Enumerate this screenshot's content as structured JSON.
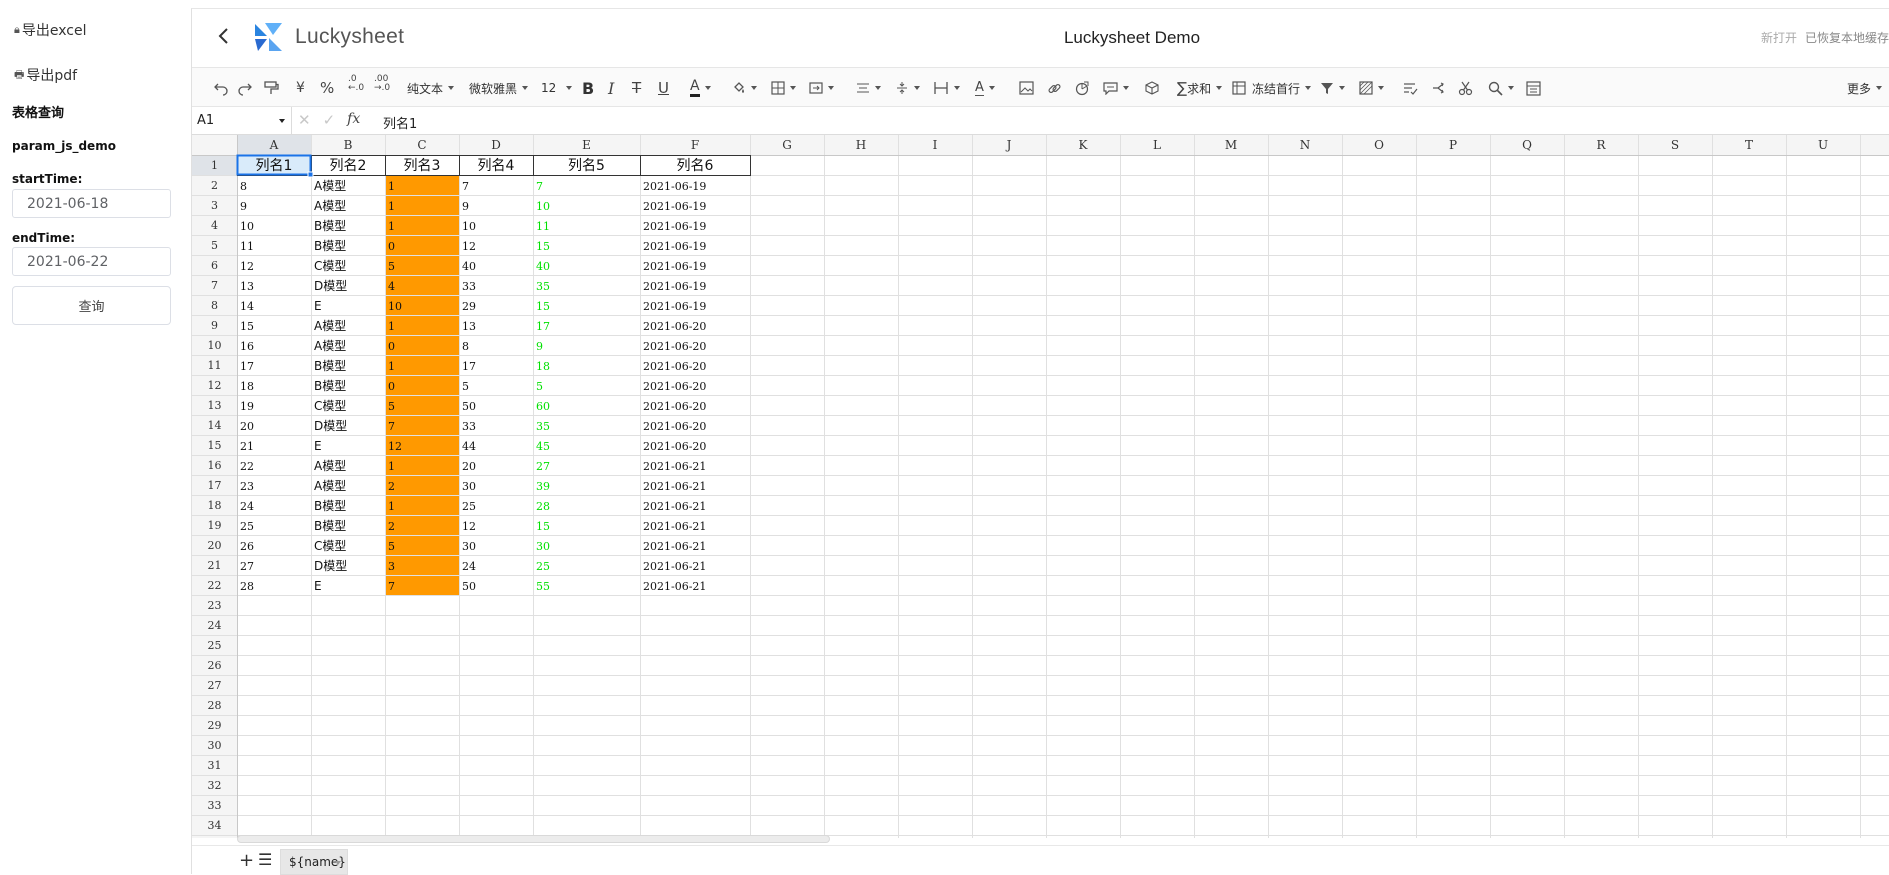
{
  "left_panel": {
    "export_excel": "导出excel",
    "export_pdf": "导出pdf",
    "section_title": "表格查询",
    "report_name": "param_js_demo",
    "start_label": "startTime:",
    "start_value": "2021-06-18",
    "end_label": "endTime:",
    "end_value": "2021-06-22",
    "query_button": "查询"
  },
  "header": {
    "brand": "Luckysheet",
    "title": "Luckysheet Demo",
    "status_new": "新打开",
    "status_cache": "已恢复本地缓存"
  },
  "toolbar": {
    "format_label": "纯文本",
    "font_label": "微软雅黑",
    "size_label": "12",
    "sum_label": "求和",
    "freeze_label": "冻结首行",
    "more_label": "更多",
    "icons": [
      "undo-icon",
      "redo-icon",
      "paint-format-icon",
      "currency-icon",
      "percent-icon",
      "decrease-decimal-icon",
      "increase-decimal-icon",
      "bold-icon",
      "italic-icon",
      "strikethrough-icon",
      "underline-icon",
      "text-color-icon",
      "fill-color-icon",
      "border-icon",
      "merge-icon",
      "align-icon",
      "valign-icon",
      "text-wrap-icon",
      "text-rotate-icon",
      "image-icon",
      "link-icon",
      "chart-icon",
      "comment-icon",
      "pivot-icon",
      "sum-icon",
      "freeze-icon",
      "filter-icon",
      "conditional-format-icon",
      "data-validation-icon",
      "split-icon",
      "screenshot-icon",
      "search-icon",
      "print-icon"
    ]
  },
  "formula_bar": {
    "cell_ref": "A1",
    "fx": "fx",
    "value": "列名1"
  },
  "grid": {
    "columns": [
      "A",
      "B",
      "C",
      "D",
      "E",
      "F",
      "G",
      "H",
      "I",
      "J",
      "K",
      "L",
      "M",
      "N",
      "O",
      "P",
      "Q",
      "R",
      "S",
      "T",
      "U"
    ],
    "row_numbers": [
      "1",
      "2",
      "3",
      "4",
      "5",
      "6",
      "7",
      "8",
      "9",
      "10",
      "11",
      "12",
      "13",
      "14",
      "15",
      "16",
      "17",
      "18",
      "19",
      "20",
      "21",
      "22",
      "23",
      "24",
      "25",
      "26",
      "27",
      "28",
      "29",
      "30",
      "31",
      "32",
      "33",
      "34"
    ],
    "header_row": [
      "列名1",
      "列名2",
      "列名3",
      "列名4",
      "列名5",
      "列名6"
    ],
    "rows": [
      [
        "8",
        "A模型",
        "1",
        "7",
        "7",
        "2021-06-19"
      ],
      [
        "9",
        "A模型",
        "1",
        "9",
        "10",
        "2021-06-19"
      ],
      [
        "10",
        "B模型",
        "1",
        "10",
        "11",
        "2021-06-19"
      ],
      [
        "11",
        "B模型",
        "0",
        "12",
        "15",
        "2021-06-19"
      ],
      [
        "12",
        "C模型",
        "5",
        "40",
        "40",
        "2021-06-19"
      ],
      [
        "13",
        "D模型",
        "4",
        "33",
        "35",
        "2021-06-19"
      ],
      [
        "14",
        "E",
        "10",
        "29",
        "15",
        "2021-06-19"
      ],
      [
        "15",
        "A模型",
        "1",
        "13",
        "17",
        "2021-06-20"
      ],
      [
        "16",
        "A模型",
        "0",
        "8",
        "9",
        "2021-06-20"
      ],
      [
        "17",
        "B模型",
        "1",
        "17",
        "18",
        "2021-06-20"
      ],
      [
        "18",
        "B模型",
        "0",
        "5",
        "5",
        "2021-06-20"
      ],
      [
        "19",
        "C模型",
        "5",
        "50",
        "60",
        "2021-06-20"
      ],
      [
        "20",
        "D模型",
        "7",
        "33",
        "35",
        "2021-06-20"
      ],
      [
        "21",
        "E",
        "12",
        "44",
        "45",
        "2021-06-20"
      ],
      [
        "22",
        "A模型",
        "1",
        "20",
        "27",
        "2021-06-21"
      ],
      [
        "23",
        "A模型",
        "2",
        "30",
        "39",
        "2021-06-21"
      ],
      [
        "24",
        "B模型",
        "1",
        "25",
        "28",
        "2021-06-21"
      ],
      [
        "25",
        "B模型",
        "2",
        "12",
        "15",
        "2021-06-21"
      ],
      [
        "26",
        "C模型",
        "5",
        "30",
        "30",
        "2021-06-21"
      ],
      [
        "27",
        "D模型",
        "3",
        "24",
        "25",
        "2021-06-21"
      ],
      [
        "28",
        "E",
        "7",
        "50",
        "55",
        "2021-06-21"
      ]
    ],
    "colors": {
      "highlight_fill": "#ff9900",
      "green_text": "#00e000",
      "selected_fill": "#d9ebfa",
      "selection_border": "#1a73e8"
    }
  },
  "sheet_tabs": {
    "add": "+",
    "list": "☰",
    "active": "${name}"
  }
}
